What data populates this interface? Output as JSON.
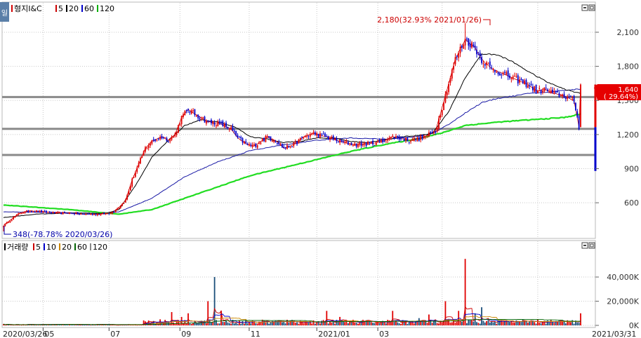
{
  "top_legend": {
    "tag": "일",
    "items": [
      {
        "label": "형지I&C",
        "color": "#d40000"
      },
      {
        "label": "5",
        "color": "#cc0000"
      },
      {
        "label": "20",
        "color": "#000000"
      },
      {
        "label": "60",
        "color": "#0000cc"
      },
      {
        "label": "120",
        "color": "#00b000"
      }
    ]
  },
  "volume_legend": {
    "items": [
      {
        "label": "거래량",
        "color": "#000000"
      },
      {
        "label": "5",
        "color": "#cc0000"
      },
      {
        "label": "10",
        "color": "#0000cc"
      },
      {
        "label": "20",
        "color": "#cc8800"
      },
      {
        "label": "60",
        "color": "#006400"
      },
      {
        "label": "120",
        "color": "#888888"
      }
    ]
  },
  "annotations": {
    "high": "2,180(32.93% 2021/01/26)",
    "low": "348(-78.78% 2020/03/26)",
    "current_price": "1,640",
    "current_change": "( 29.64%)"
  },
  "x_labels": {
    "start": "2020/03/26",
    "end": "2021/03/31",
    "months": [
      "05",
      "07",
      "09",
      "11",
      "2021/01",
      "03"
    ]
  },
  "chart_data": [
    {
      "type": "candlestick",
      "title": "형지I&C",
      "ylim": [
        348,
        2400
      ],
      "y_ticks": [
        600,
        900,
        1200,
        1500,
        1800,
        2100
      ],
      "y_tick_labels": [
        "600",
        "900",
        "1,200",
        "1,500",
        "1,800",
        "2,100"
      ],
      "horizontal_levels": [
        1020,
        1250,
        1530
      ],
      "high": {
        "value": 2180,
        "date": "2021/01/26"
      },
      "low": {
        "value": 348,
        "date": "2020/03/26"
      },
      "last": {
        "value": 1640,
        "change_pct": 29.64
      },
      "series_anchors": {
        "close": [
          [
            0,
            400
          ],
          [
            6,
            470
          ],
          [
            10,
            510
          ],
          [
            16,
            530
          ],
          [
            24,
            520
          ],
          [
            32,
            510
          ],
          [
            40,
            510
          ],
          [
            46,
            500
          ],
          [
            54,
            500
          ],
          [
            58,
            500
          ],
          [
            62,
            505
          ],
          [
            66,
            515
          ],
          [
            70,
            560
          ],
          [
            74,
            620
          ],
          [
            78,
            800
          ],
          [
            82,
            940
          ],
          [
            86,
            1080
          ],
          [
            90,
            1140
          ],
          [
            96,
            1180
          ],
          [
            100,
            1150
          ],
          [
            104,
            1200
          ],
          [
            108,
            1350
          ],
          [
            112,
            1420
          ],
          [
            116,
            1380
          ],
          [
            124,
            1310
          ],
          [
            130,
            1300
          ],
          [
            134,
            1280
          ],
          [
            138,
            1250
          ],
          [
            142,
            1170
          ],
          [
            148,
            1110
          ],
          [
            152,
            1100
          ],
          [
            160,
            1180
          ],
          [
            166,
            1140
          ],
          [
            170,
            1080
          ],
          [
            176,
            1110
          ],
          [
            182,
            1180
          ],
          [
            188,
            1210
          ],
          [
            196,
            1180
          ],
          [
            204,
            1140
          ],
          [
            210,
            1120
          ],
          [
            214,
            1110
          ],
          [
            222,
            1120
          ],
          [
            230,
            1140
          ],
          [
            236,
            1180
          ],
          [
            240,
            1170
          ],
          [
            246,
            1150
          ],
          [
            254,
            1170
          ],
          [
            262,
            1230
          ],
          [
            270,
            1650
          ],
          [
            274,
            1860
          ],
          [
            280,
            2040
          ],
          [
            286,
            1960
          ],
          [
            290,
            1860
          ],
          [
            296,
            1780
          ],
          [
            302,
            1740
          ],
          [
            310,
            1690
          ],
          [
            318,
            1640
          ],
          [
            324,
            1580
          ],
          [
            328,
            1600
          ],
          [
            334,
            1560
          ],
          [
            340,
            1540
          ],
          [
            346,
            1500
          ],
          [
            349,
            1265
          ],
          [
            350,
            1640
          ]
        ],
        "ma20": [
          [
            0,
            470
          ],
          [
            20,
            500
          ],
          [
            40,
            510
          ],
          [
            62,
            505
          ],
          [
            70,
            540
          ],
          [
            80,
            750
          ],
          [
            90,
            1000
          ],
          [
            100,
            1150
          ],
          [
            110,
            1280
          ],
          [
            120,
            1330
          ],
          [
            130,
            1310
          ],
          [
            140,
            1270
          ],
          [
            150,
            1180
          ],
          [
            160,
            1160
          ],
          [
            170,
            1130
          ],
          [
            180,
            1140
          ],
          [
            190,
            1170
          ],
          [
            200,
            1170
          ],
          [
            210,
            1140
          ],
          [
            220,
            1130
          ],
          [
            230,
            1150
          ],
          [
            240,
            1180
          ],
          [
            250,
            1190
          ],
          [
            260,
            1210
          ],
          [
            270,
            1400
          ],
          [
            280,
            1700
          ],
          [
            290,
            1910
          ],
          [
            300,
            1900
          ],
          [
            310,
            1830
          ],
          [
            320,
            1740
          ],
          [
            330,
            1660
          ],
          [
            340,
            1600
          ],
          [
            350,
            1560
          ]
        ],
        "ma60": [
          [
            0,
            520
          ],
          [
            30,
            515
          ],
          [
            60,
            505
          ],
          [
            70,
            520
          ],
          [
            90,
            640
          ],
          [
            110,
            830
          ],
          [
            130,
            960
          ],
          [
            150,
            1060
          ],
          [
            170,
            1110
          ],
          [
            190,
            1150
          ],
          [
            210,
            1170
          ],
          [
            230,
            1160
          ],
          [
            250,
            1180
          ],
          [
            260,
            1210
          ],
          [
            270,
            1290
          ],
          [
            280,
            1390
          ],
          [
            290,
            1480
          ],
          [
            300,
            1520
          ],
          [
            310,
            1540
          ],
          [
            320,
            1565
          ],
          [
            330,
            1570
          ],
          [
            340,
            1590
          ],
          [
            350,
            1600
          ]
        ],
        "ma120": [
          [
            0,
            580
          ],
          [
            20,
            560
          ],
          [
            40,
            540
          ],
          [
            62,
            510
          ],
          [
            70,
            500
          ],
          [
            90,
            540
          ],
          [
            110,
            640
          ],
          [
            130,
            740
          ],
          [
            150,
            840
          ],
          [
            170,
            910
          ],
          [
            190,
            980
          ],
          [
            210,
            1050
          ],
          [
            230,
            1110
          ],
          [
            250,
            1160
          ],
          [
            265,
            1210
          ],
          [
            280,
            1280
          ],
          [
            300,
            1310
          ],
          [
            320,
            1330
          ],
          [
            340,
            1350
          ],
          [
            350,
            1380
          ]
        ]
      }
    },
    {
      "type": "bar",
      "title": "거래량",
      "ylim": [
        0,
        65000
      ],
      "y_ticks": [
        0,
        20000,
        40000
      ],
      "y_tick_labels": [
        "0K",
        "20,000K",
        "40,000K"
      ],
      "spikes": [
        [
          90,
          3000
        ],
        [
          95,
          5000
        ],
        [
          102,
          11000
        ],
        [
          108,
          7000
        ],
        [
          112,
          10000
        ],
        [
          124,
          20000
        ],
        [
          128,
          40000
        ],
        [
          132,
          12000
        ],
        [
          196,
          12000
        ],
        [
          204,
          7000
        ],
        [
          236,
          12000
        ],
        [
          252,
          6000
        ],
        [
          258,
          9000
        ],
        [
          268,
          20000
        ],
        [
          276,
          12000
        ],
        [
          280,
          55000
        ],
        [
          286,
          10000
        ],
        [
          290,
          15000
        ],
        [
          300,
          5000
        ],
        [
          330,
          4000
        ],
        [
          350,
          10000
        ]
      ]
    }
  ]
}
